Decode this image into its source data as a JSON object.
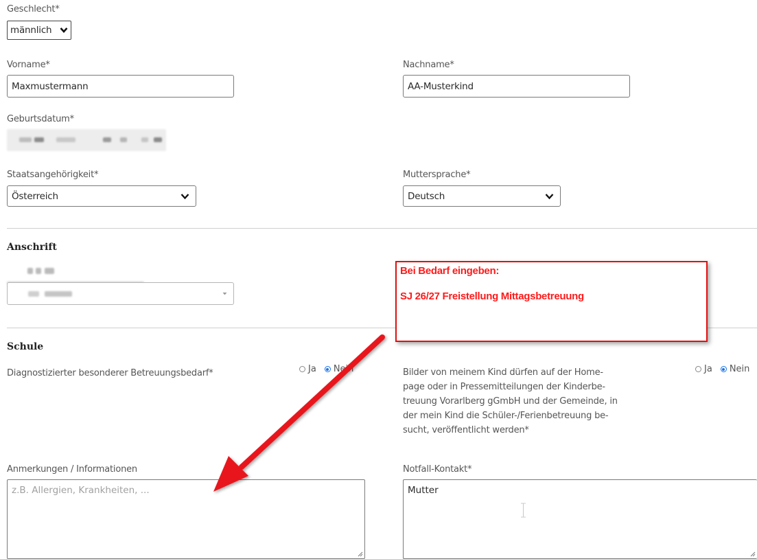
{
  "gender": {
    "label": "Geschlecht*",
    "value": "männlich"
  },
  "firstname": {
    "label": "Vorname*",
    "value": "Maxmustermann"
  },
  "lastname": {
    "label": "Nachname*",
    "value": "AA-Musterkind"
  },
  "birthdate": {
    "label": "Geburtsdatum*"
  },
  "nationality": {
    "label": "Staatsangehörigkeit*",
    "value": "Österreich"
  },
  "language": {
    "label": "Muttersprache*",
    "value": "Deutsch"
  },
  "address": {
    "heading": "Anschrift"
  },
  "callout": {
    "line1": "Bei Bedarf eingeben:",
    "line2": "SJ 26/27 Freistellung Mittagsbetreuung"
  },
  "school": {
    "heading": "Schule",
    "care_needs": {
      "label": "Diagnostizierter besonderer Betreuungsbedarf*",
      "yes": "Ja",
      "no": "Nein",
      "selected": "Nein"
    },
    "photos": {
      "label_lines": [
        "Bilder von meinem Kind dürfen auf der Home-",
        "page oder in Pressemitteilungen der Kinderbe-",
        "treuung Vorarlberg gGmbH und der Gemeinde, in",
        "der mein Kind die Schüler-/Ferienbetreuung be-",
        "sucht, veröffentlicht werden*"
      ],
      "yes": "Ja",
      "no": "Nein",
      "selected": "Nein"
    }
  },
  "remarks": {
    "label": "Anmerkungen / Informationen",
    "placeholder": "z.B. Allergien, Krankheiten, ..."
  },
  "emergency": {
    "label": "Notfall-Kontakt*",
    "value": "Mutter"
  },
  "colors": {
    "callout_red": "#ff1a1a",
    "arrow_red": "#e8141b",
    "radio_blue": "#1a73e8"
  }
}
